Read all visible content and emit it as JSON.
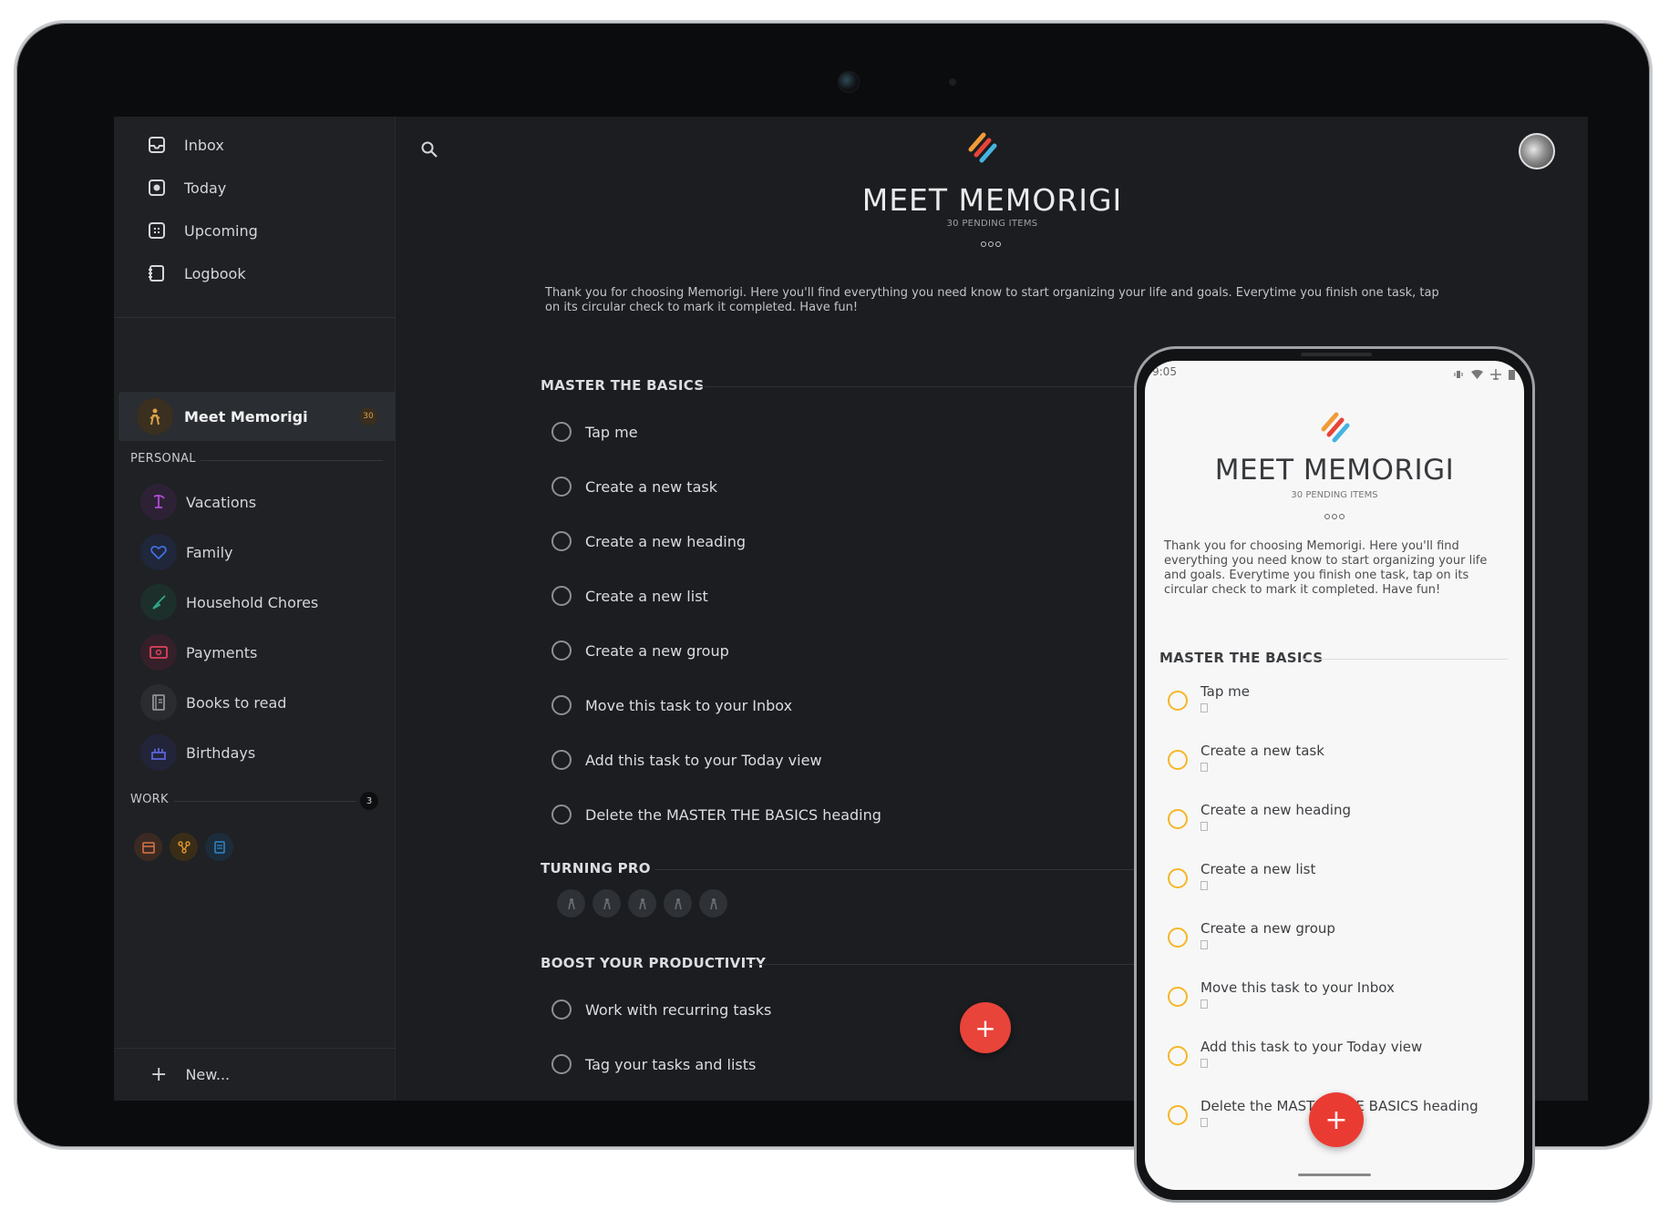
{
  "sidebar": {
    "nav": [
      {
        "label": "Inbox",
        "icon": "inbox-icon"
      },
      {
        "label": "Today",
        "icon": "today-icon"
      },
      {
        "label": "Upcoming",
        "icon": "upcoming-icon"
      },
      {
        "label": "Logbook",
        "icon": "logbook-icon"
      }
    ],
    "active_project": {
      "label": "Meet Memorigi",
      "count": "30",
      "color": "#d8a24a"
    },
    "personal": {
      "label": "PERSONAL",
      "items": [
        {
          "label": "Vacations",
          "color": "#b14bd6"
        },
        {
          "label": "Family",
          "color": "#3f6fe0"
        },
        {
          "label": "Household Chores",
          "color": "#2ea88a"
        },
        {
          "label": "Payments",
          "color": "#e0415a"
        },
        {
          "label": "Books to read",
          "color": "#8f9398"
        },
        {
          "label": "Birthdays",
          "color": "#5a63d8"
        }
      ]
    },
    "work": {
      "label": "WORK",
      "count": "3",
      "badges": [
        "#d8754a",
        "#e0962e",
        "#2f86c8"
      ]
    },
    "new_label": "New..."
  },
  "main": {
    "title": "MEET MEMORIGI",
    "subtitle": "30 PENDING ITEMS",
    "intro": "Thank you for choosing Memorigi. Here you'll find everything you need know to start organizing your life and goals. Everytime you finish one task, tap on its circular check to mark it completed. Have fun!",
    "headings": {
      "basics": "MASTER THE BASICS",
      "pro": "TURNING PRO",
      "productivity": "BOOST YOUR PRODUCTIVITY"
    },
    "basics_tasks": [
      "Tap me",
      "Create a new task",
      "Create a new heading",
      "Create a new list",
      "Create a new group",
      "Move this task to your Inbox",
      "Add this task to your Today view",
      "Delete the MASTER THE BASICS heading"
    ],
    "productivity_tasks": [
      "Work with recurring tasks",
      "Tag your tasks and lists"
    ],
    "fab_label": "+"
  },
  "phone": {
    "time": "9:05",
    "title": "MEET MEMORIGI",
    "subtitle": "30 PENDING ITEMS",
    "intro": "Thank you for choosing Memorigi. Here you'll find everything you need know to start organizing your life and goals. Everytime you finish one task, tap on its circular check to mark it completed. Have fun!",
    "heading": "MASTER THE BASICS",
    "tasks": [
      "Tap me",
      "Create a new task",
      "Create a new heading",
      "Create a new list",
      "Create a new group",
      "Move this task to your Inbox",
      "Add this task to your Today view",
      "Delete the MASTER THE BASICS heading"
    ],
    "fab_label": "+"
  },
  "colors": {
    "accent": "#e8443a",
    "logo_orange": "#f29b38",
    "logo_red": "#e8443a",
    "logo_blue": "#45b4e0",
    "phone_check": "#f4b728"
  }
}
